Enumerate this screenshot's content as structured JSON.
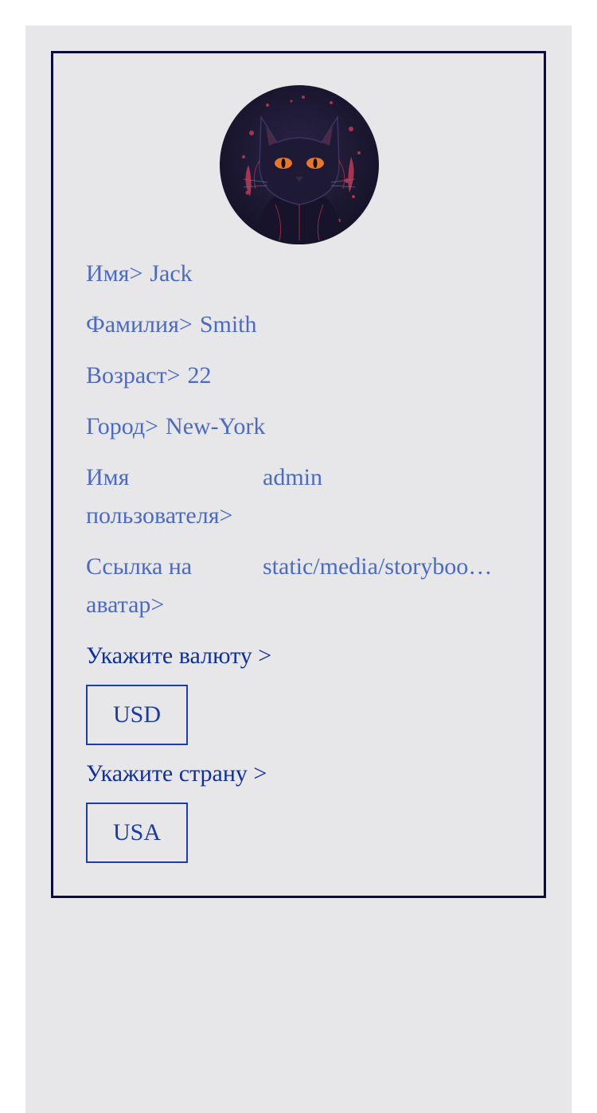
{
  "profile": {
    "avatar_alt": "black cat avatar",
    "fields": [
      {
        "label": "Имя>",
        "value": "Jack"
      },
      {
        "label": "Фамилия>",
        "value": "Smith"
      },
      {
        "label": "Возраст>",
        "value": "22"
      },
      {
        "label": "Город>",
        "value": "New-York"
      },
      {
        "label": "Имя пользователя>",
        "value": "admin"
      },
      {
        "label": "Ссылка на аватар>",
        "value": "static/media/storyboo…"
      }
    ]
  },
  "currency": {
    "prompt": "Укажите валюту >",
    "selected": "USD"
  },
  "country": {
    "prompt": "Укажите страну >",
    "selected": "USA"
  },
  "colors": {
    "text_value": "#4a6ac4",
    "prompt": "#0e2fa0",
    "card_border": "#0c0a45",
    "page_bg": "#e7e7ea"
  }
}
